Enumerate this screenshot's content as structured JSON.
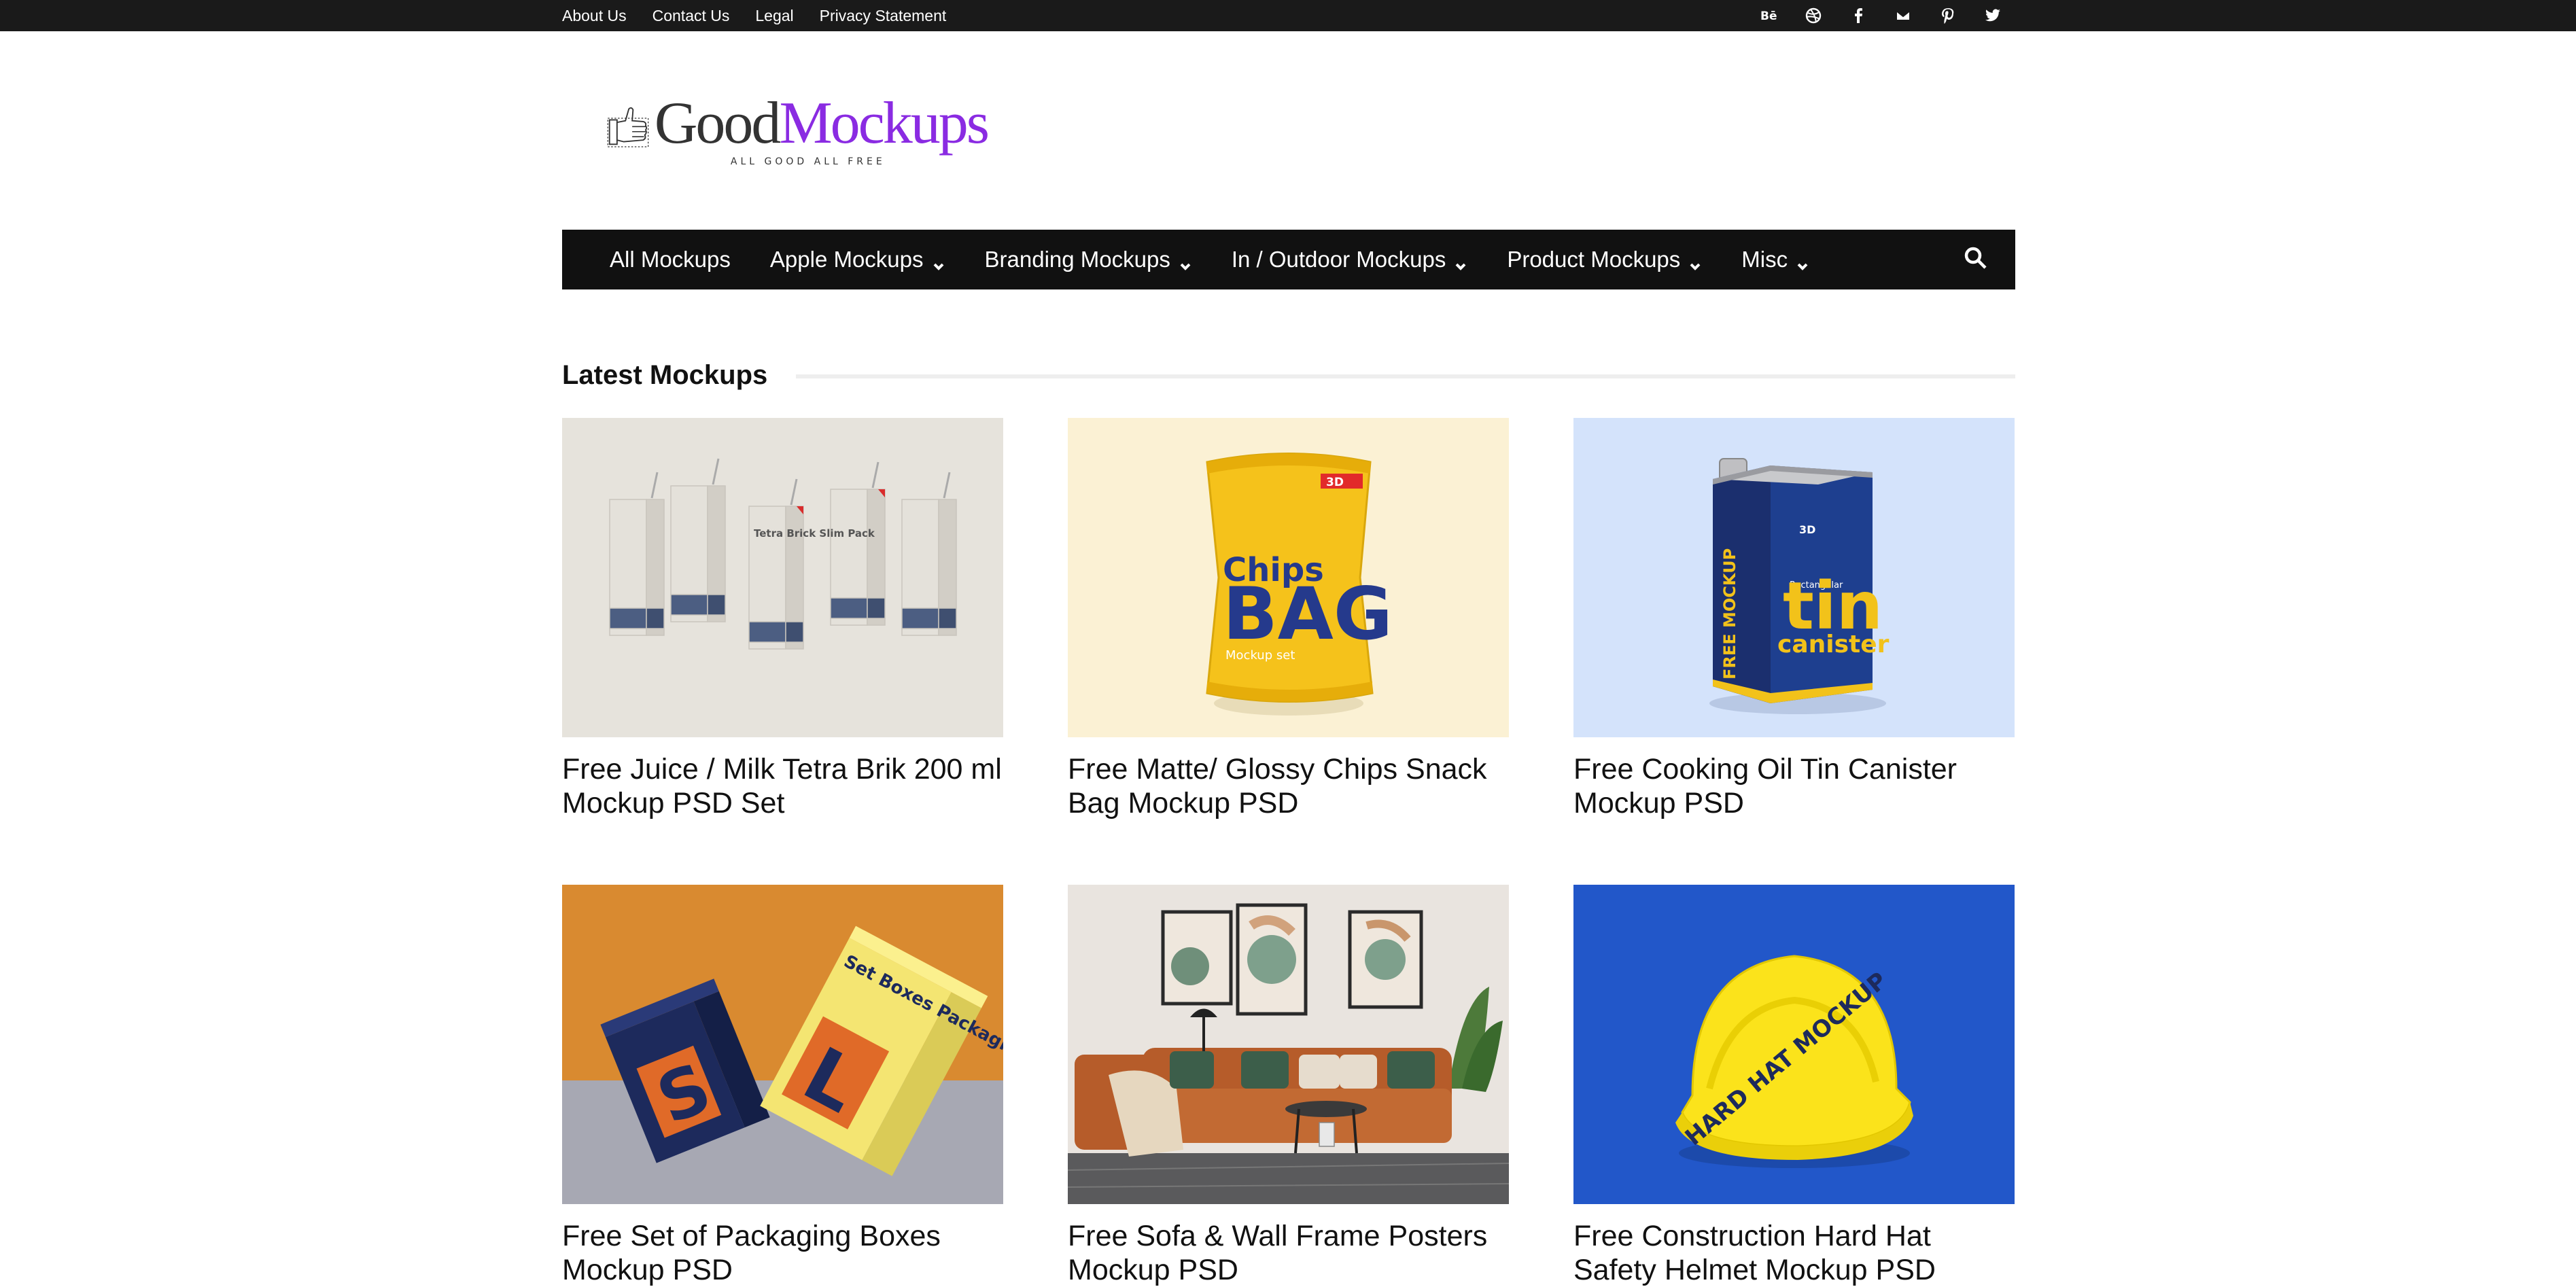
{
  "topbar": {
    "links": [
      "About Us",
      "Contact Us",
      "Legal",
      "Privacy Statement"
    ],
    "social_icons": [
      "behance-icon",
      "dribbble-icon",
      "facebook-icon",
      "mail-icon",
      "pinterest-icon",
      "twitter-icon"
    ]
  },
  "logo": {
    "word_good": "Good",
    "word_mockups": "Mockups",
    "tagline": "ALL GOOD ALL FREE",
    "brand_color": "#8a2be2"
  },
  "nav": {
    "items": [
      {
        "label": "All Mockups",
        "dropdown": false
      },
      {
        "label": "Apple Mockups",
        "dropdown": true
      },
      {
        "label": "Branding Mockups",
        "dropdown": true
      },
      {
        "label": "In / Outdoor Mockups",
        "dropdown": true
      },
      {
        "label": "Product Mockups",
        "dropdown": true
      },
      {
        "label": "Misc",
        "dropdown": true
      }
    ],
    "search_icon": "search-icon"
  },
  "section": {
    "title": "Latest Mockups"
  },
  "posts": [
    {
      "title": "Free Juice / Milk Tetra Brik 200 ml Mockup PSD Set",
      "thumb_bg": "#e6e3dc"
    },
    {
      "title": "Free Matte/ Glossy Chips Snack Bag Mockup PSD",
      "thumb_bg": "#fbf1d4"
    },
    {
      "title": "Free Cooking Oil Tin Canister Mockup PSD",
      "thumb_bg": "#d4e3fb"
    },
    {
      "title": "Free Set of Packaging Boxes Mockup PSD",
      "thumb_bg": "#d98a30"
    },
    {
      "title": "Free Sofa & Wall Frame Posters Mockup PSD",
      "thumb_bg": "#e9e4df"
    },
    {
      "title": "Free Construction Hard Hat Safety Helmet Mockup PSD",
      "thumb_bg": "#2257c9"
    }
  ],
  "thumb_text": {
    "tetra_label": "Tetra Brick Slim Pack",
    "chips_top": "Chips",
    "chips_big": "BAG",
    "chips_sub": "Mockup set",
    "chips_badge": "3D",
    "tin_side": "FREE MOCKUP",
    "tin_badge": "3D",
    "tin_word1": "tin",
    "tin_word2": "canister",
    "tin_small": "Rectangular",
    "boxes_text": "Set Boxes Packaging",
    "boxes_letter_s": "S",
    "boxes_letter_l": "L",
    "helmet_text": "HARD HAT MOCKUP"
  }
}
